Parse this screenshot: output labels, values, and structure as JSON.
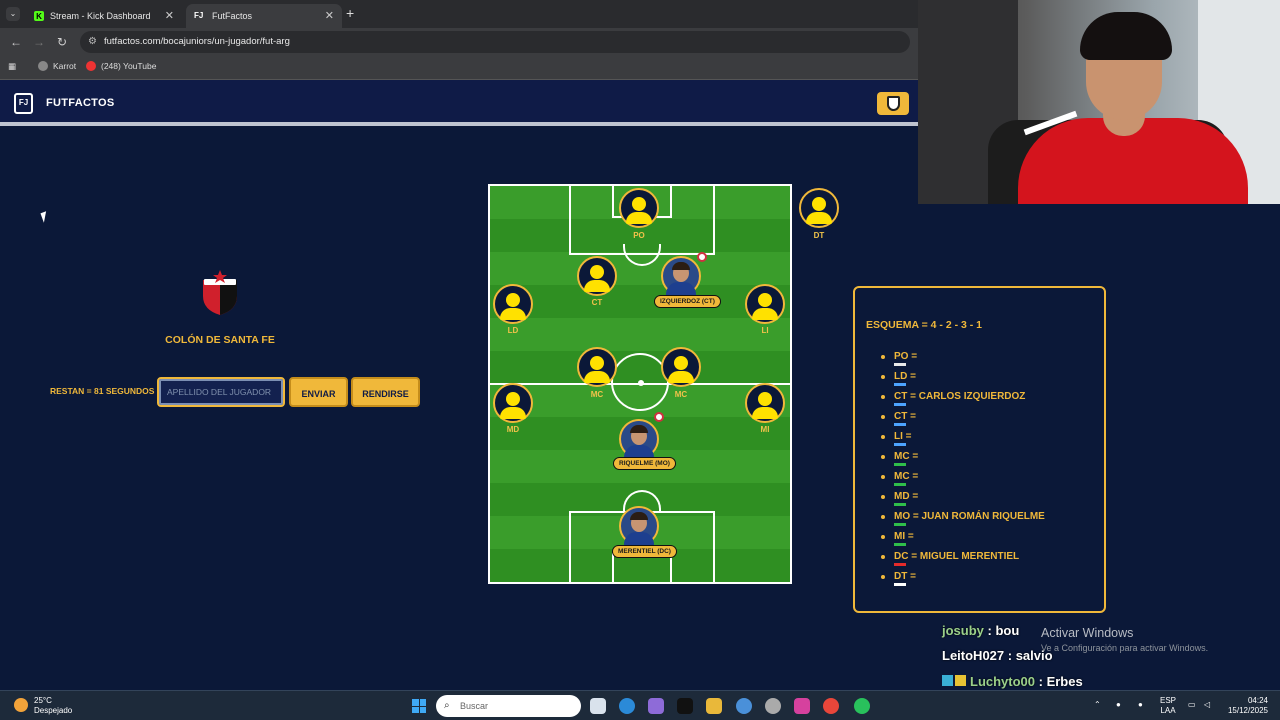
{
  "browser": {
    "tabs": [
      {
        "label": "Stream - Kick Dashboard",
        "favicon": "K"
      },
      {
        "label": "FutFactos",
        "favicon": "FJ"
      }
    ],
    "url": "futfactos.com/bocajuniors/un-jugador/fut-arg",
    "bookmarks": [
      {
        "label": "Karrot",
        "icon": "karrot-icon"
      },
      {
        "label": "(248) YouTube",
        "icon": "youtube-icon"
      }
    ]
  },
  "site": {
    "brand": "FUTFACTOS",
    "logo_text": "FJ",
    "accent": "#f0b83a",
    "background": "#0b1838"
  },
  "game": {
    "team": "COLÓN DE SANTA FE",
    "crest_text": "C.A. COLÓN",
    "timer": "RESTAN = 81 SEGUNDOS",
    "input_placeholder": "APELLIDO DEL JUGADOR",
    "send_label": "ENVIAR",
    "quit_label": "RENDIRSE"
  },
  "pitch": {
    "labels": {
      "po": "PO",
      "ct_left": "CT",
      "ld": "LD",
      "li": "LI",
      "mc_left": "MC",
      "mc_right": "MC",
      "md": "MD",
      "mi": "MI",
      "dt": "DT"
    },
    "revealed": {
      "ct_right": "IZQUIERDOZ (CT)",
      "mo": "RIQUELME (MO)",
      "dc": "MERENTIEL (DC)"
    }
  },
  "scheme": {
    "title": "ESQUEMA = 4 - 2 - 3 - 1",
    "rows": [
      {
        "pos": "PO",
        "answer": "",
        "color": "#e9e9e9"
      },
      {
        "pos": "LD",
        "answer": "",
        "color": "#4da3ff"
      },
      {
        "pos": "CT",
        "answer": "CARLOS IZQUIERDOZ",
        "color": "#4da3ff"
      },
      {
        "pos": "CT",
        "answer": "",
        "color": "#4da3ff"
      },
      {
        "pos": "LI",
        "answer": "",
        "color": "#4da3ff"
      },
      {
        "pos": "MC",
        "answer": "",
        "color": "#2fbf4a"
      },
      {
        "pos": "MC",
        "answer": "",
        "color": "#2fbf4a"
      },
      {
        "pos": "MD",
        "answer": "",
        "color": "#2fbf4a"
      },
      {
        "pos": "MO",
        "answer": "JUAN ROMÁN RIQUELME",
        "color": "#2fbf4a"
      },
      {
        "pos": "MI",
        "answer": "",
        "color": "#2fbf4a"
      },
      {
        "pos": "DC",
        "answer": "MIGUEL MERENTIEL",
        "color": "#e52b2b"
      },
      {
        "pos": "DT",
        "answer": "",
        "color": "#ffffff"
      }
    ]
  },
  "chat": [
    {
      "user": "josuby",
      "message": "bou"
    },
    {
      "user": "LeitoH027",
      "message": "salvio"
    },
    {
      "user": "Luchyto00",
      "message": "Erbes"
    }
  ],
  "watermark": {
    "title": "Activar Windows",
    "subtitle": "Ve a Configuración para activar Windows."
  },
  "taskbar": {
    "temp": "25°C",
    "condition": "Despejado",
    "search_placeholder": "Buscar",
    "lang_top": "ESP",
    "lang_bottom": "LAA",
    "time": "04:24",
    "date": "15/12/2025"
  }
}
